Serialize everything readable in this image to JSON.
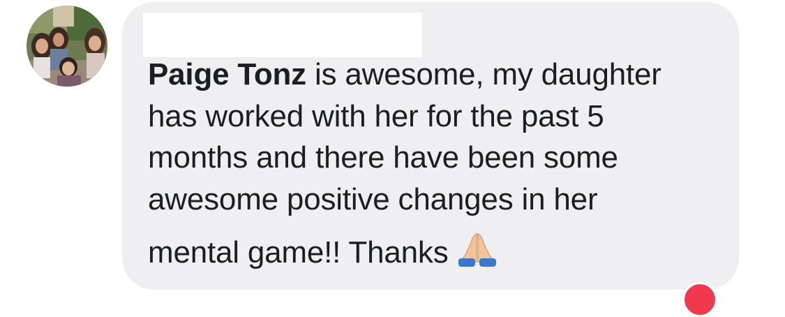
{
  "avatar": {
    "icon": "profile-photo-avatar"
  },
  "comment": {
    "author": "Paige Tonz",
    "lines": [
      "is awesome, my daughter",
      "has worked with her for the past 5",
      "months and there have been some",
      "awesome positive changes in her",
      "mental game!! Thanks"
    ],
    "emoji_icon": "folded-hands-icon",
    "bubble_color": "#efeff1",
    "text_color": "#1c1e21"
  },
  "reaction": {
    "icon": "love-reaction-icon",
    "color": "#f0394f"
  }
}
